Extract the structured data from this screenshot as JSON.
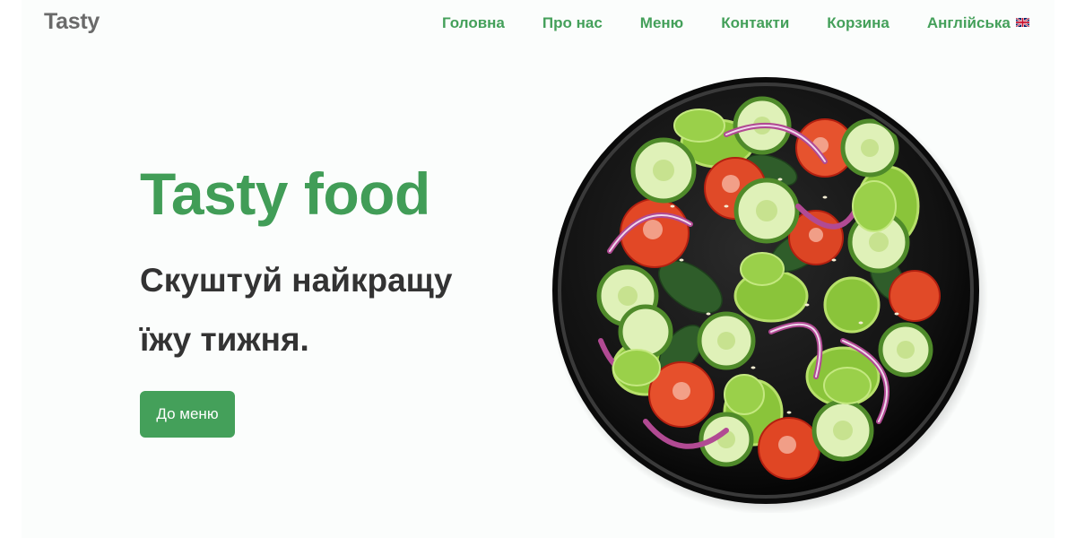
{
  "header": {
    "logo": "Tasty",
    "nav": [
      {
        "label": "Головна"
      },
      {
        "label": "Про нас"
      },
      {
        "label": "Меню"
      },
      {
        "label": "Контакти"
      },
      {
        "label": "Корзина"
      },
      {
        "label": "Англійська"
      }
    ],
    "language_flag_icon": "uk-flag-icon"
  },
  "hero": {
    "title": "Tasty food",
    "subtitle": "Скуштуй найкращу їжу тижня.",
    "cta_label": "До меню",
    "image_icon": "salad-bowl-image"
  },
  "colors": {
    "accent": "#44a05a",
    "title": "#419d57",
    "text_dark": "#333333",
    "logo": "#6a6a6a",
    "background": "#fbfdfc"
  }
}
